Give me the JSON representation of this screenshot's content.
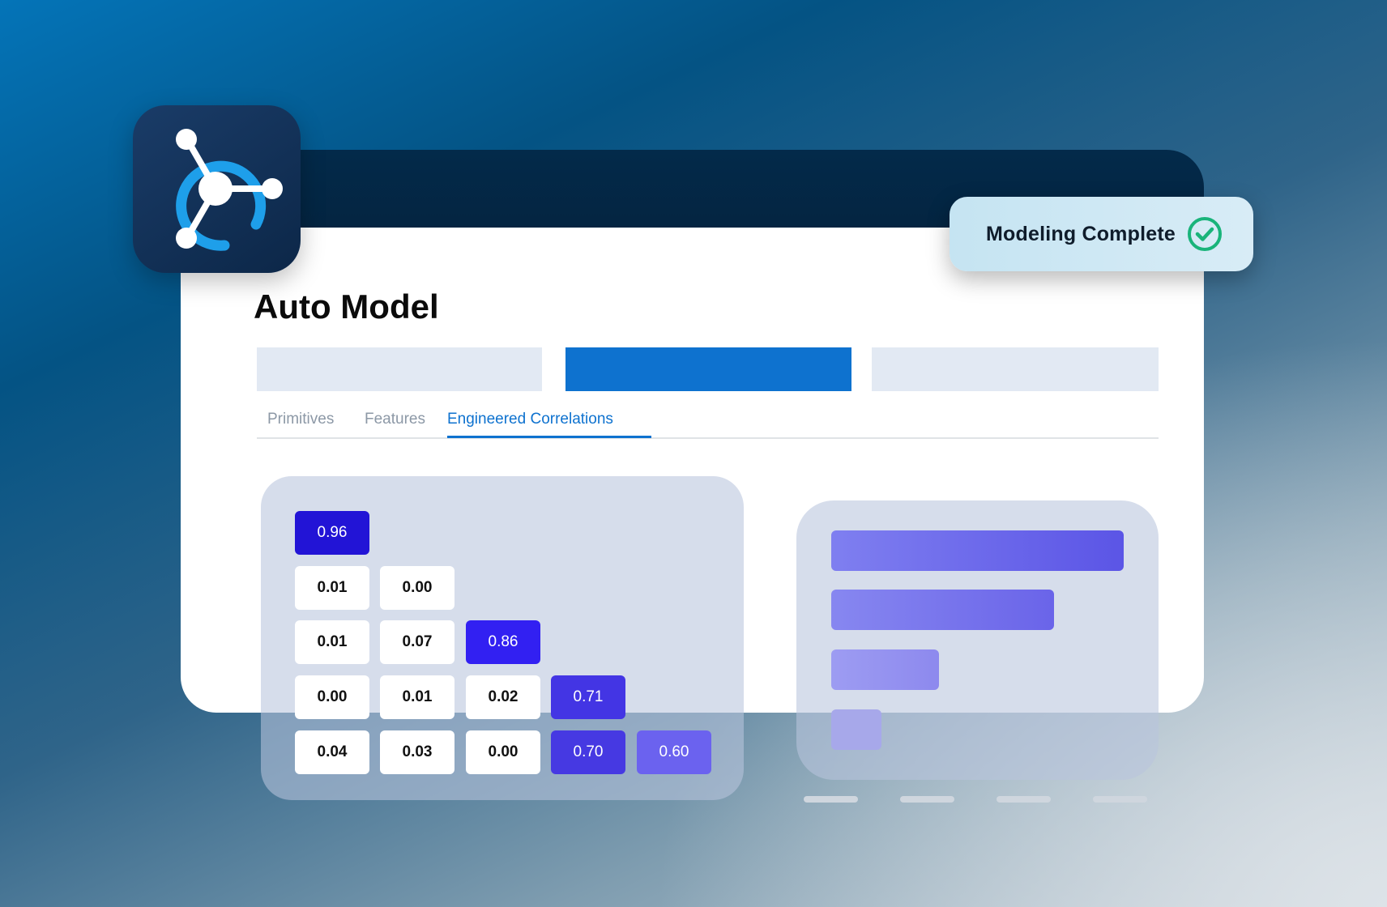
{
  "app": {
    "title": "Auto Model"
  },
  "status": {
    "label": "Modeling Complete",
    "icon": "check-circle-icon",
    "icon_color": "#19b47a"
  },
  "colors": {
    "accent": "#0e72cf",
    "tab_inactive": "#8c98a6"
  },
  "tabs": [
    {
      "label": "Primitives",
      "active": false
    },
    {
      "label": "Features",
      "active": false
    },
    {
      "label": "Engineered Correlations",
      "active": true
    }
  ],
  "correlation_matrix": {
    "rows": [
      [
        {
          "value": "0.96",
          "color": "#2214d6"
        }
      ],
      [
        {
          "value": "0.01"
        },
        {
          "value": "0.00"
        }
      ],
      [
        {
          "value": "0.01"
        },
        {
          "value": "0.07"
        },
        {
          "value": "0.86",
          "color": "#3220f2"
        }
      ],
      [
        {
          "value": "0.00"
        },
        {
          "value": "0.01"
        },
        {
          "value": "0.02"
        },
        {
          "value": "0.71",
          "color": "#4335e4"
        }
      ],
      [
        {
          "value": "0.04"
        },
        {
          "value": "0.03"
        },
        {
          "value": "0.00"
        },
        {
          "value": "0.70",
          "color": "#4639e2"
        },
        {
          "value": "0.60",
          "color": "#6b62ef"
        }
      ]
    ]
  }
}
